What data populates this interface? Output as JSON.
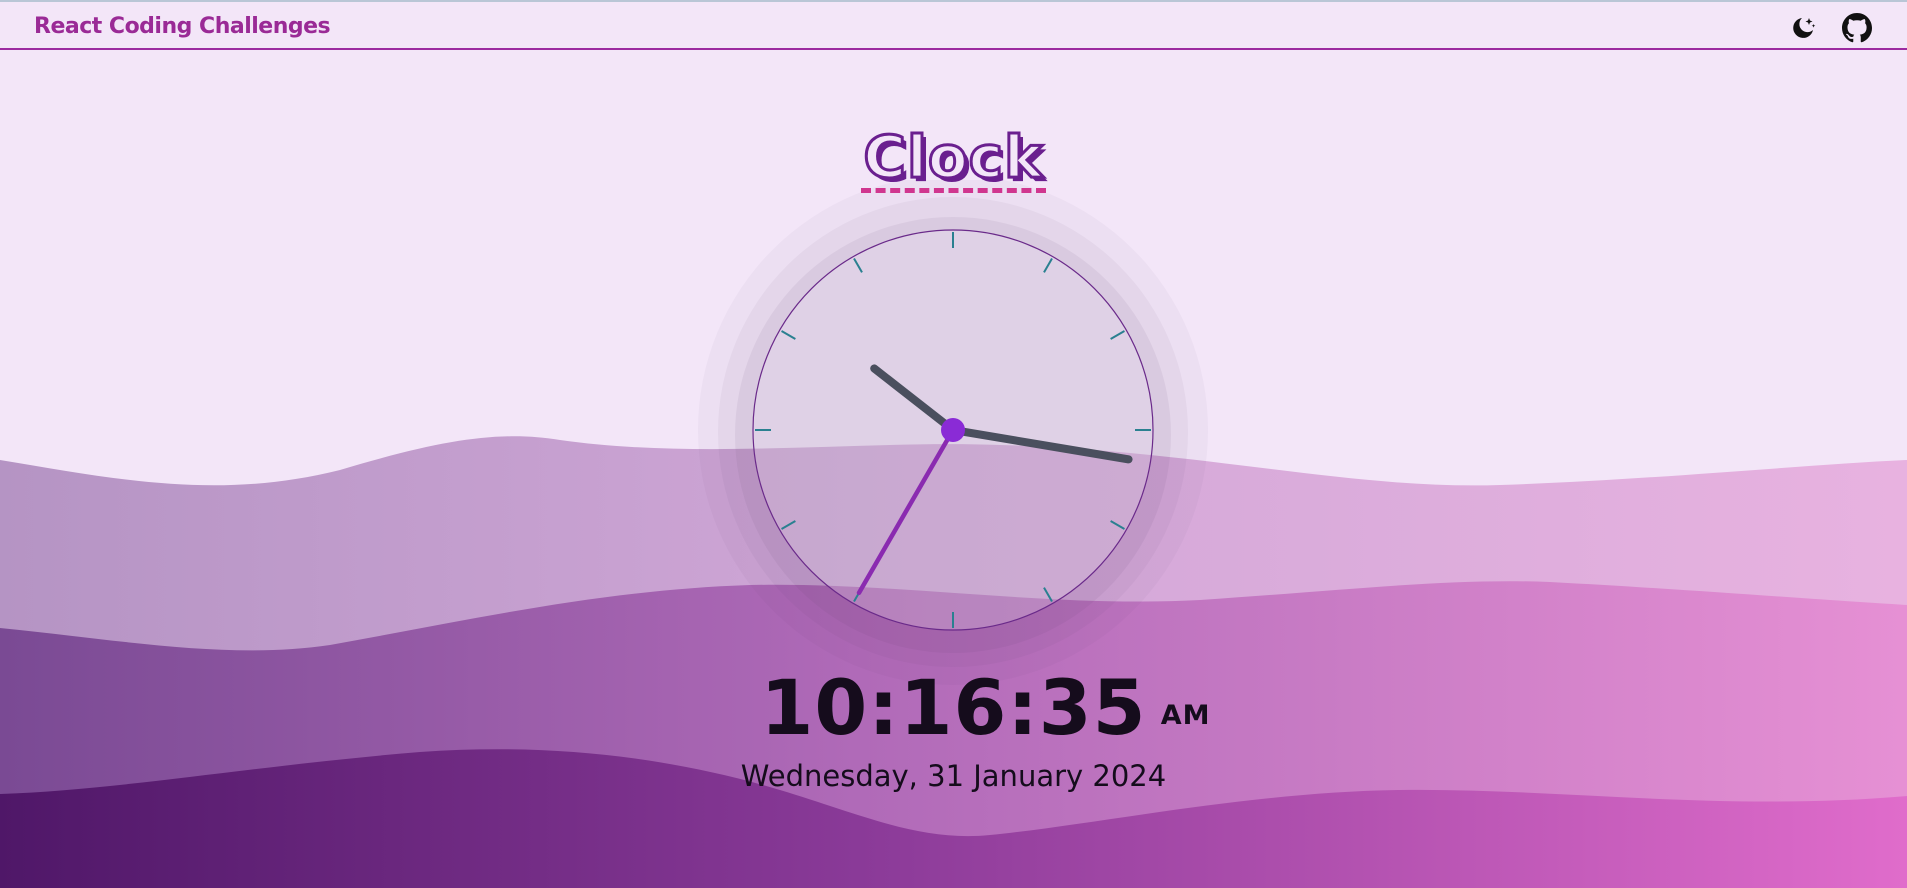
{
  "navbar": {
    "brand": "React Coding Challenges",
    "theme_toggle_icon": "moon-stars-icon",
    "github_icon": "github-icon"
  },
  "page": {
    "title": "Clock"
  },
  "clock": {
    "hour": 10,
    "minute": 16,
    "second": 35,
    "time_text": "10:16:35",
    "meridiem": "AM",
    "date_text": "Wednesday, 31 January 2024"
  },
  "colors": {
    "background": "#f3e6f8",
    "brand": "#9a2a96",
    "accent": "#8a2bd6",
    "title_stroke": "#6a1f8f",
    "title_underline": "#d0368f",
    "second_hand": "#8a2bb0",
    "hour_minute_hands": "#4a4f5e",
    "tick_marks": "#2a8090",
    "wave_dark": "#4f1768",
    "wave_pink": "#e06ccb"
  }
}
